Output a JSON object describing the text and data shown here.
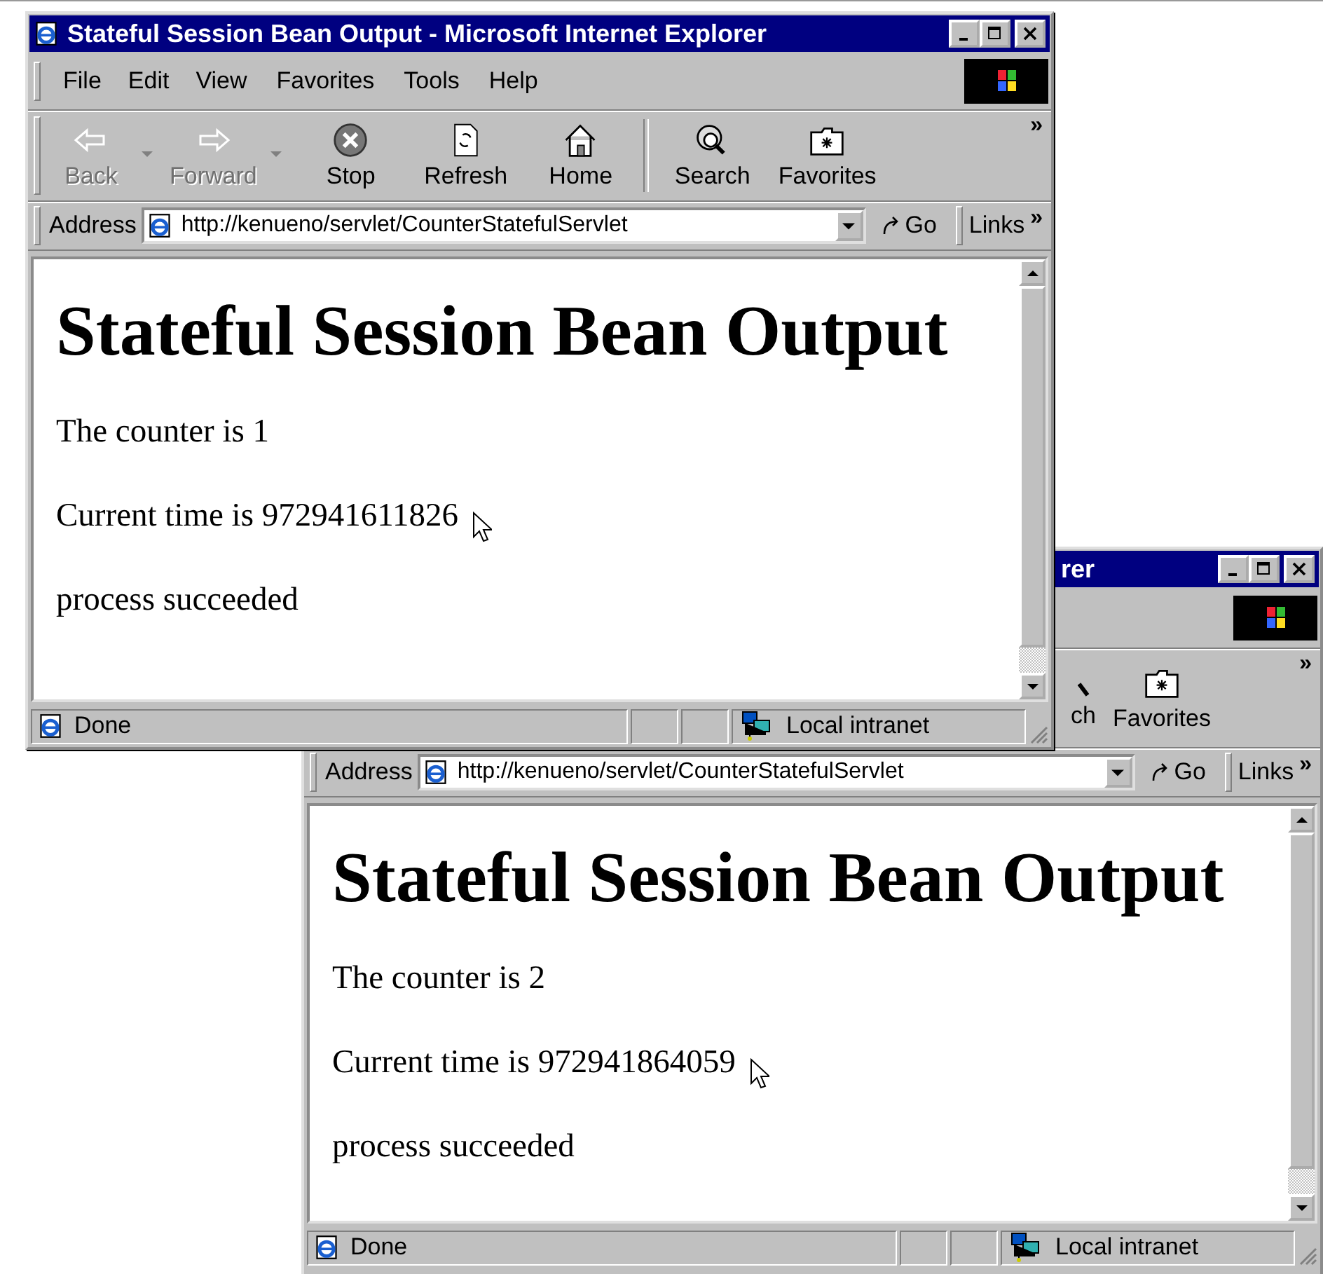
{
  "windows": [
    {
      "kind": "full",
      "title": "Stateful Session Bean Output - Microsoft Internet Explorer",
      "menu": [
        "File",
        "Edit",
        "View",
        "Favorites",
        "Tools",
        "Help"
      ],
      "toolbar": [
        {
          "kind": "back",
          "label": "Back",
          "disabled": true,
          "dropdown": true
        },
        {
          "kind": "forward",
          "label": "Forward",
          "disabled": true,
          "dropdown": true
        },
        {
          "kind": "stop",
          "label": "Stop",
          "disabled": false,
          "dropdown": false
        },
        {
          "kind": "refresh",
          "label": "Refresh",
          "disabled": false,
          "dropdown": false
        },
        {
          "kind": "home",
          "label": "Home",
          "disabled": false,
          "dropdown": false
        },
        {
          "kind": "search",
          "label": "Search",
          "disabled": false,
          "dropdown": false
        },
        {
          "kind": "favorites",
          "label": "Favorites",
          "disabled": false,
          "dropdown": false
        }
      ],
      "toolbar_more": "»",
      "address": {
        "label": "Address",
        "value": "http://kenueno/servlet/CounterStatefulServlet",
        "go": "Go",
        "links": "Links",
        "more": "»"
      },
      "page": {
        "heading": "Stateful Session Bean Output",
        "paragraphs": [
          "The counter is 1",
          "Current time is 972941611826",
          "process succeeded"
        ]
      },
      "status": {
        "text": "Done",
        "zone": "Local intranet"
      }
    },
    {
      "kind": "partial",
      "title": "rer",
      "toolbar": [
        {
          "kind": "search",
          "label": "ch",
          "disabled": false,
          "dropdown": false
        },
        {
          "kind": "favorites",
          "label": "Favorites",
          "disabled": false,
          "dropdown": false
        }
      ],
      "toolbar_more": "»",
      "address": {
        "label": "Address",
        "value": "http://kenueno/servlet/CounterStatefulServlet",
        "go": "Go",
        "links": "Links",
        "more": "»"
      },
      "page": {
        "heading": "Stateful Session Bean Output",
        "paragraphs": [
          "The counter is 2",
          "Current time is 972941864059",
          "process succeeded"
        ]
      },
      "status": {
        "text": "Done",
        "zone": "Local intranet"
      }
    }
  ]
}
